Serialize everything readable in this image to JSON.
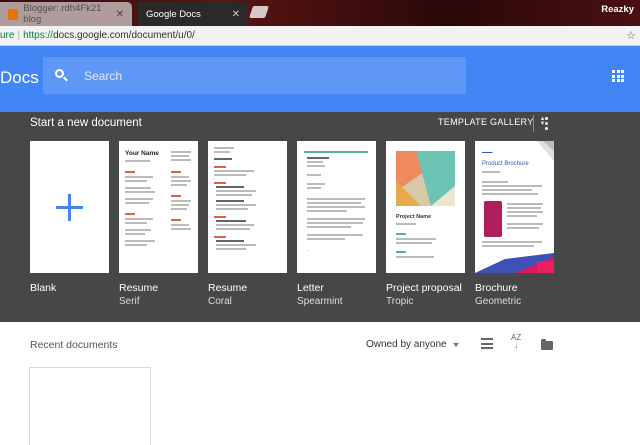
{
  "browser": {
    "tabs": [
      {
        "title": "Blogger: rdh4Fk21 blog",
        "active": false
      },
      {
        "title": "Google Docs",
        "active": true
      }
    ],
    "profile_name": "Reazky",
    "address": {
      "secure_label": "ure",
      "scheme": "https://",
      "url_rest": "docs.google.com/document/u/0/"
    }
  },
  "header": {
    "app_title": "Docs",
    "search_placeholder": "Search",
    "accent": "#4285f4"
  },
  "templates": {
    "section_title": "Start a new document",
    "gallery_label": "TEMPLATE GALLERY",
    "items": [
      {
        "name": "Blank",
        "sub": ""
      },
      {
        "name": "Resume",
        "sub": "Serif",
        "thumb_title": "Your Name"
      },
      {
        "name": "Resume",
        "sub": "Coral"
      },
      {
        "name": "Letter",
        "sub": "Spearmint"
      },
      {
        "name": "Project proposal",
        "sub": "Tropic",
        "thumb_title": "Project Name"
      },
      {
        "name": "Brochure",
        "sub": "Geometric",
        "thumb_title": "Product Brochure"
      }
    ]
  },
  "recent": {
    "title": "Recent documents",
    "owner_filter": "Owned by anyone",
    "sort_label": "AZ"
  }
}
